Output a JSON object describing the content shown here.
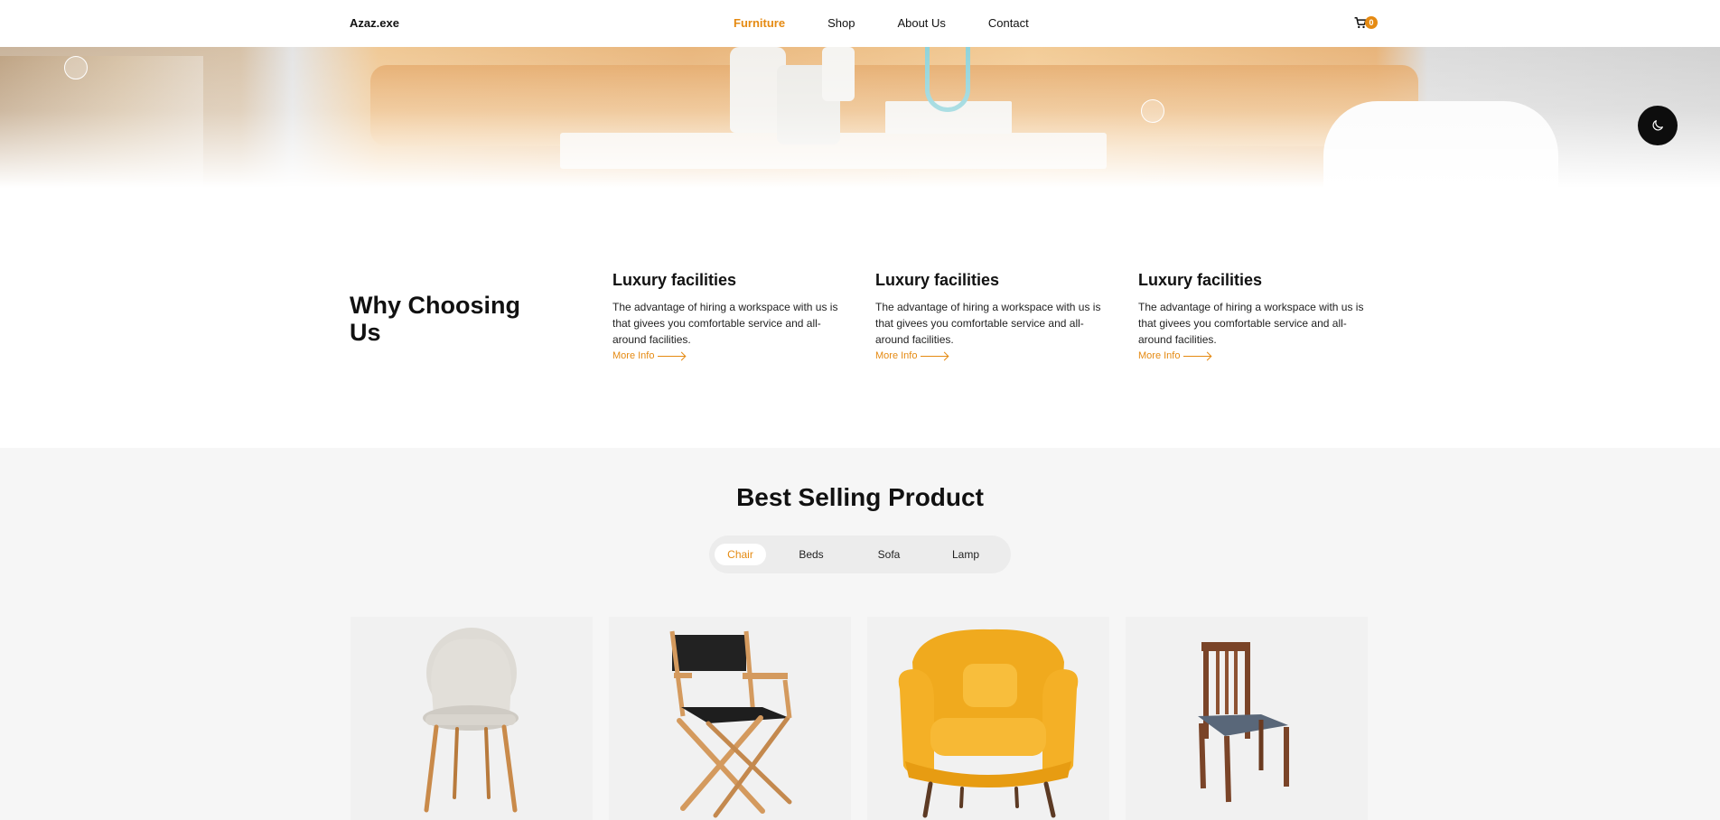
{
  "nav": {
    "brand": "Azaz.exe",
    "items": [
      {
        "label": "Furniture",
        "active": true
      },
      {
        "label": "Shop",
        "active": false
      },
      {
        "label": "About Us",
        "active": false
      },
      {
        "label": "Contact",
        "active": false
      }
    ],
    "cart_icon": "cart-icon",
    "cart_count": "0"
  },
  "hero": {
    "dark_mode_icon": "moon-icon"
  },
  "why": {
    "title": "Why Choosing Us",
    "features": [
      {
        "title": "Luxury facilities",
        "text": "The advantage of hiring a workspace with us is that givees you comfortable service and all-around facilities.",
        "link": "More Info"
      },
      {
        "title": "Luxury facilities",
        "text": "The advantage of hiring a workspace with us is that givees you comfortable service and all-around facilities.",
        "link": "More Info"
      },
      {
        "title": "Luxury facilities",
        "text": "The advantage of hiring a workspace with us is that givees you comfortable service and all-around facilities.",
        "link": "More Info"
      }
    ]
  },
  "best": {
    "title": "Best Selling Product",
    "tabs": [
      {
        "label": "Chair",
        "active": true
      },
      {
        "label": "Beds",
        "active": false
      },
      {
        "label": "Sofa",
        "active": false
      },
      {
        "label": "Lamp",
        "active": false
      }
    ],
    "products": [
      {
        "image": "white-upholstered-chair-image"
      },
      {
        "image": "directors-chair-image"
      },
      {
        "image": "yellow-leather-armchair-image"
      },
      {
        "image": "wooden-dining-chair-image"
      }
    ]
  },
  "colors": {
    "accent": "#e58a12",
    "dark": "#0d0d0d",
    "section_bg": "#f6f6f6"
  }
}
